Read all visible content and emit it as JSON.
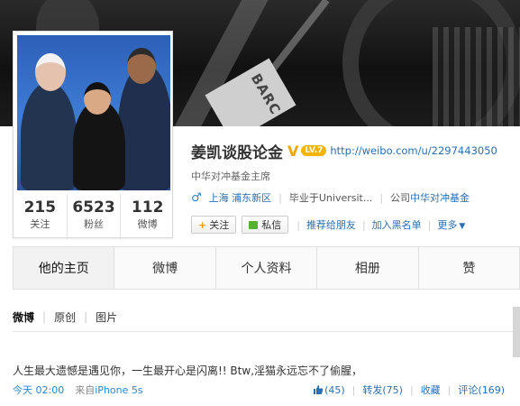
{
  "cover": {
    "plate_text": "BARC"
  },
  "profile": {
    "stats": [
      {
        "num": "215",
        "label": "关注"
      },
      {
        "num": "6523",
        "label": "粉丝"
      },
      {
        "num": "112",
        "label": "微博"
      }
    ]
  },
  "user": {
    "name": "姜凯谈股论金",
    "verified": "V",
    "level": "LV.7",
    "url": "http://weibo.com/u/2297443050",
    "intro": "中华对冲基金主席",
    "gender_icon": "♂",
    "location": "上海 浦东新区",
    "school": "毕业于Universit...",
    "company_prefix": "公司",
    "company": "中华对冲基金"
  },
  "actions": {
    "follow": "关注",
    "message": "私信",
    "recommend": "推荐给朋友",
    "blacklist": "加入黑名单",
    "more": "更多"
  },
  "tabs": [
    "他的主页",
    "微博",
    "个人资料",
    "相册",
    "赞"
  ],
  "subtabs": [
    "微博",
    "原创",
    "图片"
  ],
  "post": {
    "text": "人生最大遗憾是遇见你，一生最开心是闪离!! Btw,淫猫永远忘不了偷腥，",
    "time": "今天 02:00",
    "source_prefix": "来自",
    "source": "iPhone 5s",
    "likes": "(45)",
    "repost": "转发(75)",
    "favorite": "收藏",
    "comment": "评论(169)"
  },
  "colors": {
    "link": "#2a6fb3",
    "time": "#2a87d6",
    "badge": "#f5b400"
  }
}
